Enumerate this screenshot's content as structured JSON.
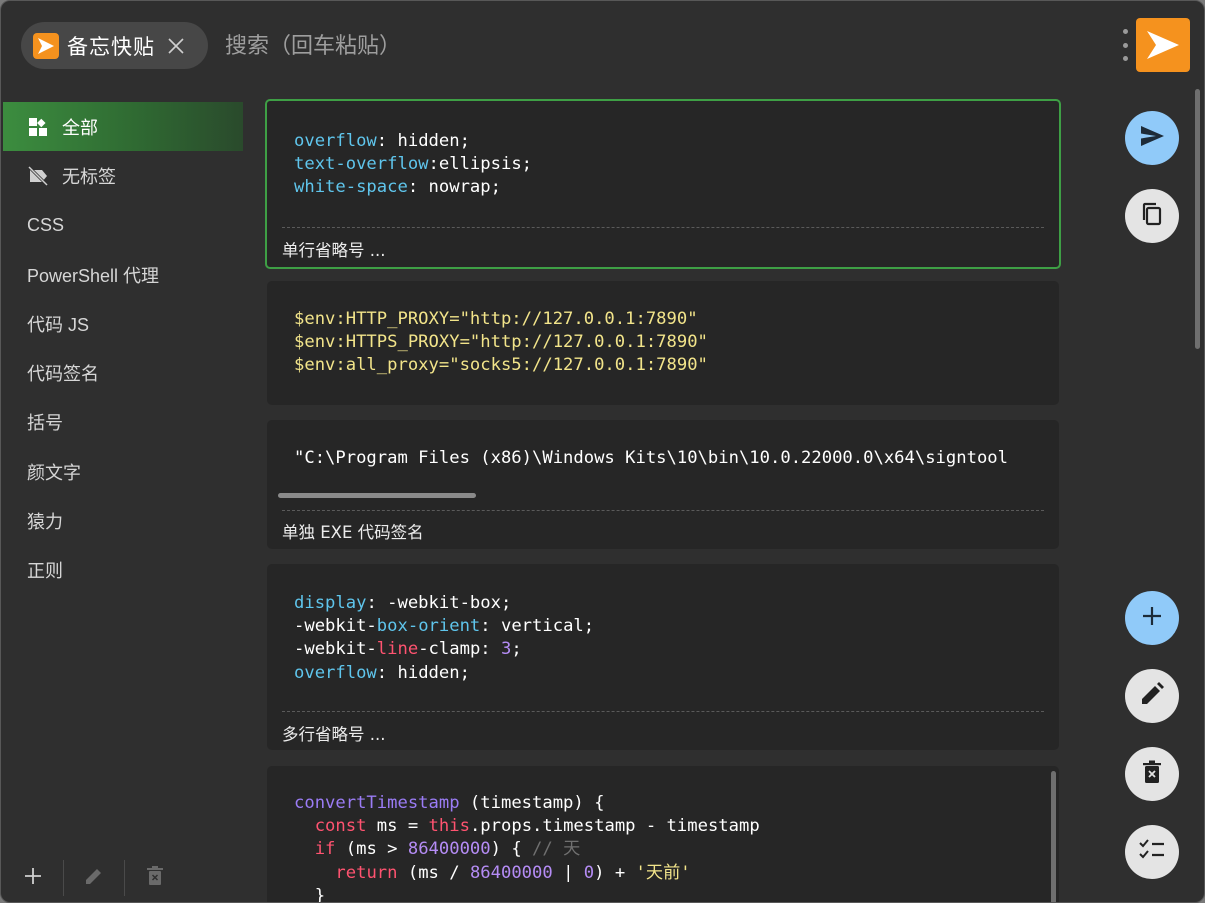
{
  "header": {
    "app_tab_label": "备忘快贴",
    "search_placeholder": "搜索（回车粘贴）"
  },
  "sidebar": {
    "items": [
      {
        "label": "全部",
        "icon": "dashboard-icon",
        "active": true
      },
      {
        "label": "无标签",
        "icon": "label-off-icon",
        "active": false
      },
      {
        "label": "CSS"
      },
      {
        "label": "PowerShell 代理"
      },
      {
        "label": "代码 JS"
      },
      {
        "label": "代码签名"
      },
      {
        "label": "括号"
      },
      {
        "label": "颜文字"
      },
      {
        "label": "猿力"
      },
      {
        "label": "正则"
      }
    ],
    "bottom_actions": [
      "add-icon",
      "edit-icon",
      "delete-icon"
    ]
  },
  "snippets": [
    {
      "lines": [
        [
          [
            "overflow",
            "prop"
          ],
          [
            ": hidden;",
            "plain"
          ]
        ],
        [
          [
            "text-overflow",
            "prop"
          ],
          [
            ":ellipsis;",
            "plain"
          ]
        ],
        [
          [
            "white-space",
            "prop"
          ],
          [
            ": nowrap;",
            "plain"
          ]
        ]
      ],
      "note": "单行省略号 ...",
      "selected": true
    },
    {
      "lines": [
        [
          [
            "$env:HTTP_PROXY=\"http://127.0.0.1:7890\"",
            "str"
          ]
        ],
        [
          [
            "$env:HTTPS_PROXY=\"http://127.0.0.1:7890\"",
            "str"
          ]
        ],
        [
          [
            "$env:all_proxy=\"socks5://127.0.0.1:7890\"",
            "str"
          ]
        ]
      ],
      "note": ""
    },
    {
      "lines": [
        [
          [
            "\"C:\\Program Files (x86)\\Windows Kits\\10\\bin\\10.0.22000.0\\x64\\signtool",
            "plain"
          ]
        ]
      ],
      "note": "单独 EXE 代码签名"
    },
    {
      "lines": [
        [
          [
            "display",
            "prop"
          ],
          [
            ": -webkit-box;",
            "plain"
          ]
        ],
        [
          [
            "-webkit-",
            "plain"
          ],
          [
            "box-orient",
            "prop"
          ],
          [
            ": vertical;",
            "plain"
          ]
        ],
        [
          [
            "-webkit-",
            "plain"
          ],
          [
            "line",
            "red"
          ],
          [
            "-clamp: ",
            "plain"
          ],
          [
            "3",
            "num"
          ],
          [
            ";",
            "plain"
          ]
        ],
        [
          [
            "overflow",
            "prop"
          ],
          [
            ": hidden;",
            "plain"
          ]
        ]
      ],
      "note": "多行省略号 ..."
    },
    {
      "lines": [
        [
          [
            "convertTimestamp",
            "purple"
          ],
          [
            " (timestamp) {",
            "plain"
          ]
        ],
        [
          [
            "  ",
            "plain"
          ],
          [
            "const",
            "red"
          ],
          [
            " ms = ",
            "plain"
          ],
          [
            "this",
            "red"
          ],
          [
            ".props.timestamp - timestamp",
            "plain"
          ]
        ],
        [
          [
            "  ",
            "plain"
          ],
          [
            "if",
            "red"
          ],
          [
            " (ms > ",
            "plain"
          ],
          [
            "86400000",
            "num"
          ],
          [
            ") { ",
            "plain"
          ],
          [
            "// 天",
            "cmt"
          ]
        ],
        [
          [
            "    ",
            "plain"
          ],
          [
            "return",
            "red"
          ],
          [
            " (ms / ",
            "plain"
          ],
          [
            "86400000",
            "num"
          ],
          [
            " | ",
            "plain"
          ],
          [
            "0",
            "num"
          ],
          [
            ") + ",
            "plain"
          ],
          [
            "'天前'",
            "str"
          ]
        ],
        [
          [
            "  }",
            "plain"
          ]
        ]
      ],
      "note": ""
    }
  ],
  "actions": {
    "top": [
      "send-icon",
      "copy-icon"
    ],
    "bottom": [
      "add-icon",
      "edit-icon",
      "delete-icon",
      "checklist-icon"
    ]
  },
  "colors": {
    "accent_green": "#3e9f45",
    "brand_orange": "#f5921e",
    "fab_blue": "#90caf9"
  }
}
